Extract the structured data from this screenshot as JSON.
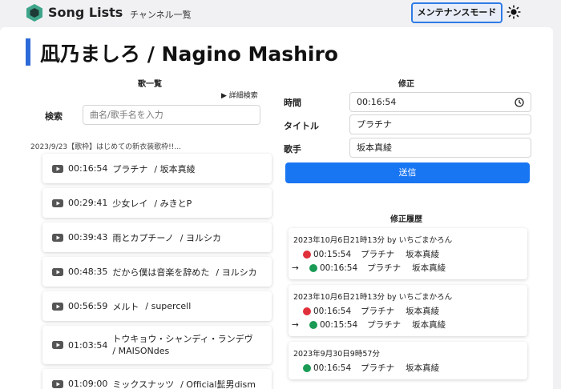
{
  "header": {
    "brand": "Song Lists",
    "nav_link": "チャンネル一覧",
    "maintenance_button": "メンテナンスモード",
    "theme_icon": "sun-icon",
    "colors": {
      "accent": "#2e7be6"
    }
  },
  "page": {
    "title": "凪乃ましろ / Nagino Mashiro"
  },
  "song_list": {
    "heading": "歌一覧",
    "advanced_search": "▶ 詳細検索",
    "search_label": "検索",
    "search_placeholder": "曲名/歌手名を入力",
    "video_title": "2023/9/23【歌枠】はじめての新衣装歌枠!!...",
    "items": [
      {
        "time": "00:16:54",
        "title": "プラチナ",
        "artist": "/ 坂本真綾"
      },
      {
        "time": "00:29:41",
        "title": "少女レイ",
        "artist": "/ みきとP"
      },
      {
        "time": "00:39:43",
        "title": "雨とカプチーノ",
        "artist": "/ ヨルシカ"
      },
      {
        "time": "00:48:35",
        "title": "だから僕は音楽を辞めた",
        "artist": "/ ヨルシカ"
      },
      {
        "time": "00:56:59",
        "title": "メルト",
        "artist": "/ supercell"
      },
      {
        "time": "01:03:54",
        "title": "トウキョウ・シャンディ・ランデヴ",
        "artist": "/ MAISONdes"
      },
      {
        "time": "01:09:00",
        "title": "ミックスナッツ",
        "artist": "/ Official髭男dism"
      }
    ]
  },
  "edit_form": {
    "heading": "修正",
    "time_label": "時間",
    "time_value": "00:16:54",
    "title_label": "タイトル",
    "title_value": "プラチナ",
    "artist_label": "歌手",
    "artist_value": "坂本真綾",
    "submit_label": "送信",
    "colors": {
      "submit": "#1976f2"
    }
  },
  "history": {
    "heading": "修正履歴",
    "arrow": "→",
    "colors": {
      "old": "#e0303a",
      "new": "#1a9b55"
    },
    "entries": [
      {
        "meta": "2023年10月6日21時13分  by いちごまかろん",
        "old": {
          "time": "00:15:54",
          "title": "プラチナ",
          "artist": "坂本真綾"
        },
        "new": {
          "time": "00:16:54",
          "title": "プラチナ",
          "artist": "坂本真綾"
        }
      },
      {
        "meta": "2023年10月6日21時13分  by いちごまかろん",
        "old": {
          "time": "00:16:54",
          "title": "プラチナ",
          "artist": "坂本真綾"
        },
        "new": {
          "time": "00:15:54",
          "title": "プラチナ",
          "artist": "坂本真綾"
        }
      },
      {
        "meta": "2023年9月30日9時57分",
        "new": {
          "time": "00:16:54",
          "title": "プラチナ",
          "artist": "坂本真綾"
        }
      }
    ]
  }
}
